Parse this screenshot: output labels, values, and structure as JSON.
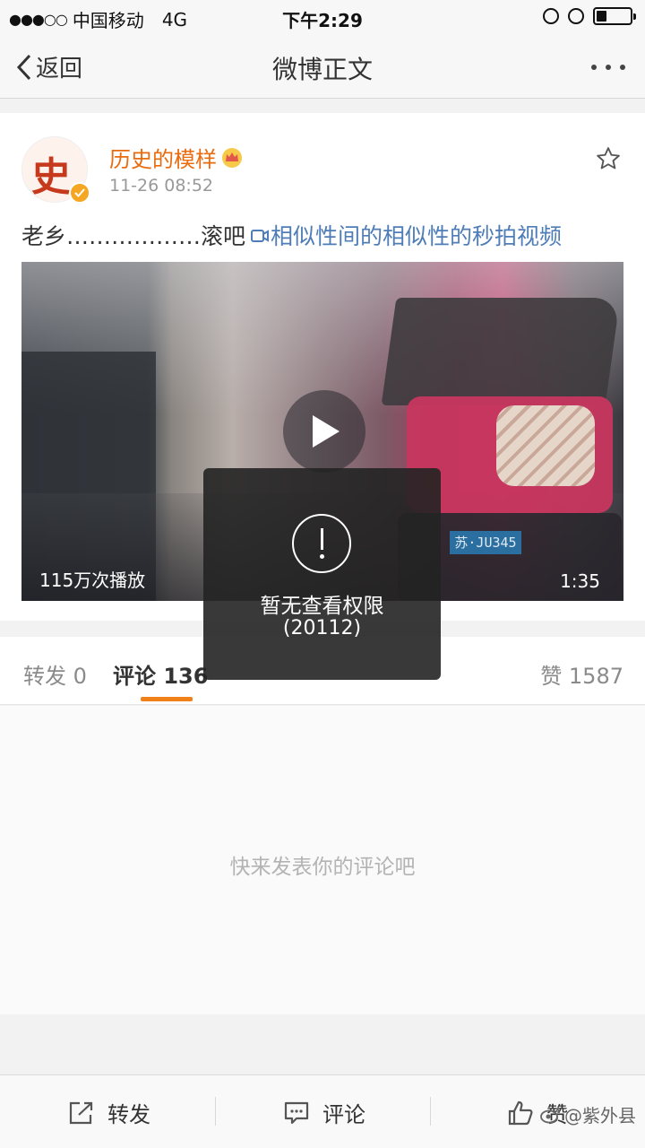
{
  "status_bar": {
    "signal_dots": "●●●○○",
    "carrier": "中国移动",
    "network": "4G",
    "time": "下午2:29",
    "battery_level": 0.3
  },
  "nav": {
    "back_label": "返回",
    "title": "微博正文"
  },
  "post": {
    "avatar_glyph": "史",
    "user_name": "历史的模样",
    "time": "11-26 08:52",
    "text": "老乡………………滚吧",
    "link_text": "相似性间的相似性的秒拍视频",
    "video": {
      "views": "115万次播放",
      "duration": "1:35",
      "plate_text": "苏·JU345"
    }
  },
  "tabs": {
    "repost": "转发 0",
    "comment": "评论 136",
    "like": "赞 1587"
  },
  "empty_hint": "快来发表你的评论吧",
  "toast": {
    "message": "暂无查看权限",
    "code": "(20112)"
  },
  "bottom_bar": {
    "repost": "转发",
    "comment": "评论",
    "like": "赞"
  },
  "watermark": "@紫外县",
  "colors": {
    "accent_orange": "#f08119",
    "username_orange": "#e86b0f",
    "link_blue": "#4f7db7",
    "verified_badge": "#f5a623"
  },
  "icons": [
    "back-chevron-icon",
    "more-dots-icon",
    "star-icon",
    "crown-icon",
    "verified-badge-icon",
    "video-link-icon",
    "play-icon",
    "alert-icon",
    "repost-icon",
    "comment-icon",
    "thumbs-up-icon",
    "weibo-logo-icon"
  ]
}
